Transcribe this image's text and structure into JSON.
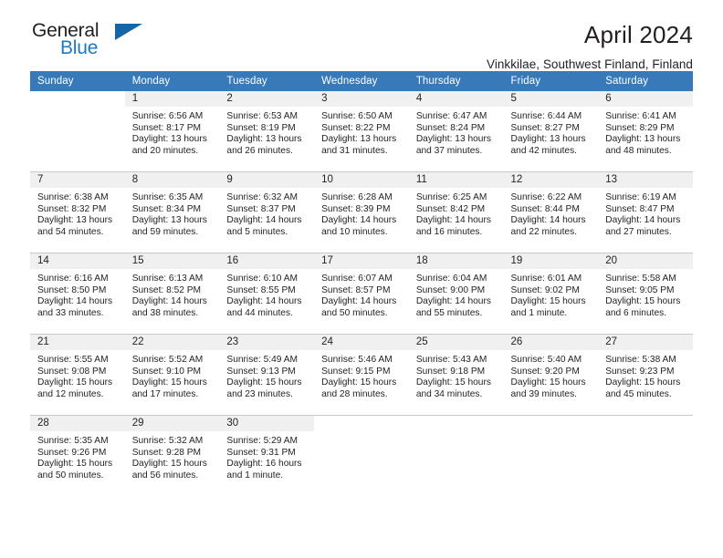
{
  "brand": {
    "name_top": "General",
    "name_bottom": "Blue",
    "triangle_color": "#1565a8",
    "blue_color": "#1c7ac0"
  },
  "header": {
    "title": "April 2024",
    "subtitle": "Vinkkilae, Southwest Finland, Finland",
    "header_bg": "#3779b9",
    "daynum_band_bg": "#f0f0f0"
  },
  "weekdays": [
    "Sunday",
    "Monday",
    "Tuesday",
    "Wednesday",
    "Thursday",
    "Friday",
    "Saturday"
  ],
  "labels": {
    "sunrise_prefix": "Sunrise:",
    "sunset_prefix": "Sunset:",
    "daylight_prefix": "Daylight:"
  },
  "weeks": [
    [
      {
        "day": "",
        "sunrise": "",
        "sunset": "",
        "daylight_line1": "",
        "daylight_line2": ""
      },
      {
        "day": "1",
        "sunrise": "Sunrise: 6:56 AM",
        "sunset": "Sunset: 8:17 PM",
        "daylight_line1": "Daylight: 13 hours",
        "daylight_line2": "and 20 minutes."
      },
      {
        "day": "2",
        "sunrise": "Sunrise: 6:53 AM",
        "sunset": "Sunset: 8:19 PM",
        "daylight_line1": "Daylight: 13 hours",
        "daylight_line2": "and 26 minutes."
      },
      {
        "day": "3",
        "sunrise": "Sunrise: 6:50 AM",
        "sunset": "Sunset: 8:22 PM",
        "daylight_line1": "Daylight: 13 hours",
        "daylight_line2": "and 31 minutes."
      },
      {
        "day": "4",
        "sunrise": "Sunrise: 6:47 AM",
        "sunset": "Sunset: 8:24 PM",
        "daylight_line1": "Daylight: 13 hours",
        "daylight_line2": "and 37 minutes."
      },
      {
        "day": "5",
        "sunrise": "Sunrise: 6:44 AM",
        "sunset": "Sunset: 8:27 PM",
        "daylight_line1": "Daylight: 13 hours",
        "daylight_line2": "and 42 minutes."
      },
      {
        "day": "6",
        "sunrise": "Sunrise: 6:41 AM",
        "sunset": "Sunset: 8:29 PM",
        "daylight_line1": "Daylight: 13 hours",
        "daylight_line2": "and 48 minutes."
      }
    ],
    [
      {
        "day": "7",
        "sunrise": "Sunrise: 6:38 AM",
        "sunset": "Sunset: 8:32 PM",
        "daylight_line1": "Daylight: 13 hours",
        "daylight_line2": "and 54 minutes."
      },
      {
        "day": "8",
        "sunrise": "Sunrise: 6:35 AM",
        "sunset": "Sunset: 8:34 PM",
        "daylight_line1": "Daylight: 13 hours",
        "daylight_line2": "and 59 minutes."
      },
      {
        "day": "9",
        "sunrise": "Sunrise: 6:32 AM",
        "sunset": "Sunset: 8:37 PM",
        "daylight_line1": "Daylight: 14 hours",
        "daylight_line2": "and 5 minutes."
      },
      {
        "day": "10",
        "sunrise": "Sunrise: 6:28 AM",
        "sunset": "Sunset: 8:39 PM",
        "daylight_line1": "Daylight: 14 hours",
        "daylight_line2": "and 10 minutes."
      },
      {
        "day": "11",
        "sunrise": "Sunrise: 6:25 AM",
        "sunset": "Sunset: 8:42 PM",
        "daylight_line1": "Daylight: 14 hours",
        "daylight_line2": "and 16 minutes."
      },
      {
        "day": "12",
        "sunrise": "Sunrise: 6:22 AM",
        "sunset": "Sunset: 8:44 PM",
        "daylight_line1": "Daylight: 14 hours",
        "daylight_line2": "and 22 minutes."
      },
      {
        "day": "13",
        "sunrise": "Sunrise: 6:19 AM",
        "sunset": "Sunset: 8:47 PM",
        "daylight_line1": "Daylight: 14 hours",
        "daylight_line2": "and 27 minutes."
      }
    ],
    [
      {
        "day": "14",
        "sunrise": "Sunrise: 6:16 AM",
        "sunset": "Sunset: 8:50 PM",
        "daylight_line1": "Daylight: 14 hours",
        "daylight_line2": "and 33 minutes."
      },
      {
        "day": "15",
        "sunrise": "Sunrise: 6:13 AM",
        "sunset": "Sunset: 8:52 PM",
        "daylight_line1": "Daylight: 14 hours",
        "daylight_line2": "and 38 minutes."
      },
      {
        "day": "16",
        "sunrise": "Sunrise: 6:10 AM",
        "sunset": "Sunset: 8:55 PM",
        "daylight_line1": "Daylight: 14 hours",
        "daylight_line2": "and 44 minutes."
      },
      {
        "day": "17",
        "sunrise": "Sunrise: 6:07 AM",
        "sunset": "Sunset: 8:57 PM",
        "daylight_line1": "Daylight: 14 hours",
        "daylight_line2": "and 50 minutes."
      },
      {
        "day": "18",
        "sunrise": "Sunrise: 6:04 AM",
        "sunset": "Sunset: 9:00 PM",
        "daylight_line1": "Daylight: 14 hours",
        "daylight_line2": "and 55 minutes."
      },
      {
        "day": "19",
        "sunrise": "Sunrise: 6:01 AM",
        "sunset": "Sunset: 9:02 PM",
        "daylight_line1": "Daylight: 15 hours",
        "daylight_line2": "and 1 minute."
      },
      {
        "day": "20",
        "sunrise": "Sunrise: 5:58 AM",
        "sunset": "Sunset: 9:05 PM",
        "daylight_line1": "Daylight: 15 hours",
        "daylight_line2": "and 6 minutes."
      }
    ],
    [
      {
        "day": "21",
        "sunrise": "Sunrise: 5:55 AM",
        "sunset": "Sunset: 9:08 PM",
        "daylight_line1": "Daylight: 15 hours",
        "daylight_line2": "and 12 minutes."
      },
      {
        "day": "22",
        "sunrise": "Sunrise: 5:52 AM",
        "sunset": "Sunset: 9:10 PM",
        "daylight_line1": "Daylight: 15 hours",
        "daylight_line2": "and 17 minutes."
      },
      {
        "day": "23",
        "sunrise": "Sunrise: 5:49 AM",
        "sunset": "Sunset: 9:13 PM",
        "daylight_line1": "Daylight: 15 hours",
        "daylight_line2": "and 23 minutes."
      },
      {
        "day": "24",
        "sunrise": "Sunrise: 5:46 AM",
        "sunset": "Sunset: 9:15 PM",
        "daylight_line1": "Daylight: 15 hours",
        "daylight_line2": "and 28 minutes."
      },
      {
        "day": "25",
        "sunrise": "Sunrise: 5:43 AM",
        "sunset": "Sunset: 9:18 PM",
        "daylight_line1": "Daylight: 15 hours",
        "daylight_line2": "and 34 minutes."
      },
      {
        "day": "26",
        "sunrise": "Sunrise: 5:40 AM",
        "sunset": "Sunset: 9:20 PM",
        "daylight_line1": "Daylight: 15 hours",
        "daylight_line2": "and 39 minutes."
      },
      {
        "day": "27",
        "sunrise": "Sunrise: 5:38 AM",
        "sunset": "Sunset: 9:23 PM",
        "daylight_line1": "Daylight: 15 hours",
        "daylight_line2": "and 45 minutes."
      }
    ],
    [
      {
        "day": "28",
        "sunrise": "Sunrise: 5:35 AM",
        "sunset": "Sunset: 9:26 PM",
        "daylight_line1": "Daylight: 15 hours",
        "daylight_line2": "and 50 minutes."
      },
      {
        "day": "29",
        "sunrise": "Sunrise: 5:32 AM",
        "sunset": "Sunset: 9:28 PM",
        "daylight_line1": "Daylight: 15 hours",
        "daylight_line2": "and 56 minutes."
      },
      {
        "day": "30",
        "sunrise": "Sunrise: 5:29 AM",
        "sunset": "Sunset: 9:31 PM",
        "daylight_line1": "Daylight: 16 hours",
        "daylight_line2": "and 1 minute."
      },
      {
        "day": "",
        "sunrise": "",
        "sunset": "",
        "daylight_line1": "",
        "daylight_line2": ""
      },
      {
        "day": "",
        "sunrise": "",
        "sunset": "",
        "daylight_line1": "",
        "daylight_line2": ""
      },
      {
        "day": "",
        "sunrise": "",
        "sunset": "",
        "daylight_line1": "",
        "daylight_line2": ""
      },
      {
        "day": "",
        "sunrise": "",
        "sunset": "",
        "daylight_line1": "",
        "daylight_line2": ""
      }
    ]
  ]
}
